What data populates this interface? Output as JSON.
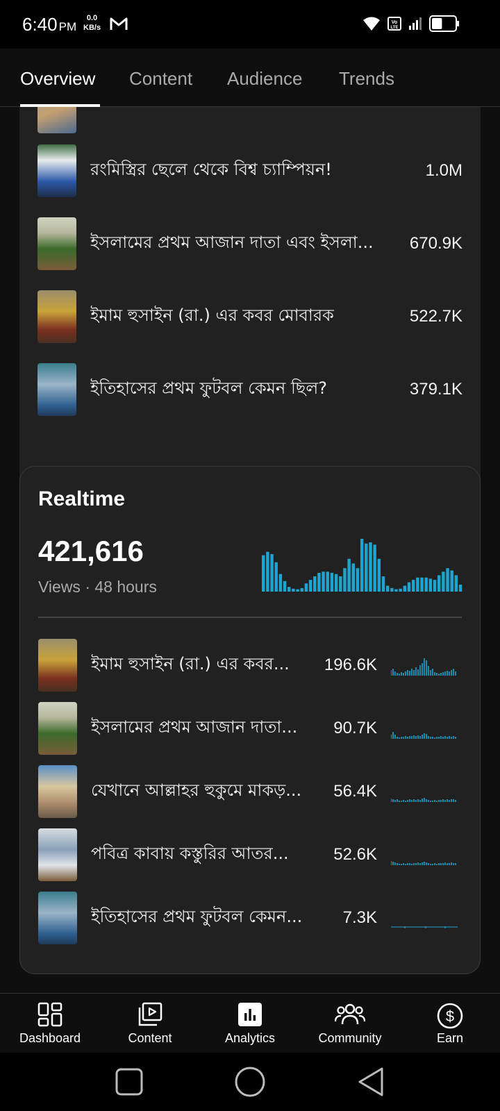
{
  "status_bar": {
    "time": "6:40",
    "ampm": "PM",
    "net_speed_value": "0.0",
    "net_speed_unit": "KB/s",
    "battery_level": 0.45
  },
  "tabs": [
    {
      "label": "Overview",
      "active": true
    },
    {
      "label": "Content",
      "active": false
    },
    {
      "label": "Audience",
      "active": false
    },
    {
      "label": "Trends",
      "active": false
    }
  ],
  "top_content": {
    "rows": [
      {
        "title": "রংমিস্ত্রির ছেলে থেকে বিশ্ব চ্যাম্পিয়ন!",
        "value": "1.0M"
      },
      {
        "title": "ইসলামের প্রথম আজান দাতা এবং ইসলা...",
        "value": "670.9K"
      },
      {
        "title": "ইমাম হুসাইন (রা.) এর কবর মোবারক",
        "value": "522.7K"
      },
      {
        "title": "ইতিহাসের প্রথম ফুটবল কেমন ছিল?",
        "value": "379.1K"
      }
    ]
  },
  "realtime": {
    "title": "Realtime",
    "views": "421,616",
    "subtitle": "Views · 48 hours",
    "rows": [
      {
        "title": "ইমাম হুসাইন (রা.) এর কবর...",
        "value": "196.6K"
      },
      {
        "title": "ইসলামের প্রথম আজান দাতা...",
        "value": "90.7K"
      },
      {
        "title": "যেখানে আল্লাহর হুকুমে মাকড়...",
        "value": "56.4K"
      },
      {
        "title": "পবিত্র কাবায় কস্তুরির আতর...",
        "value": "52.6K"
      },
      {
        "title": "ইতিহাসের প্রথম ফুটবল কেমন...",
        "value": "7.3K"
      }
    ]
  },
  "chart_data": {
    "type": "bar",
    "bar_color": "#1fa3cf",
    "values": [
      62,
      68,
      64,
      50,
      30,
      18,
      8,
      5,
      4,
      6,
      14,
      20,
      26,
      32,
      34,
      34,
      32,
      30,
      26,
      40,
      56,
      48,
      40,
      90,
      82,
      84,
      80,
      56,
      26,
      10,
      6,
      4,
      5,
      10,
      16,
      20,
      24,
      24,
      24,
      22,
      20,
      28,
      34,
      40,
      36,
      28,
      12
    ]
  },
  "bottom_nav": [
    {
      "label": "Dashboard",
      "icon": "dashboard-icon"
    },
    {
      "label": "Content",
      "icon": "content-icon"
    },
    {
      "label": "Analytics",
      "icon": "analytics-icon",
      "active": true
    },
    {
      "label": "Community",
      "icon": "community-icon"
    },
    {
      "label": "Earn",
      "icon": "earn-icon"
    }
  ]
}
